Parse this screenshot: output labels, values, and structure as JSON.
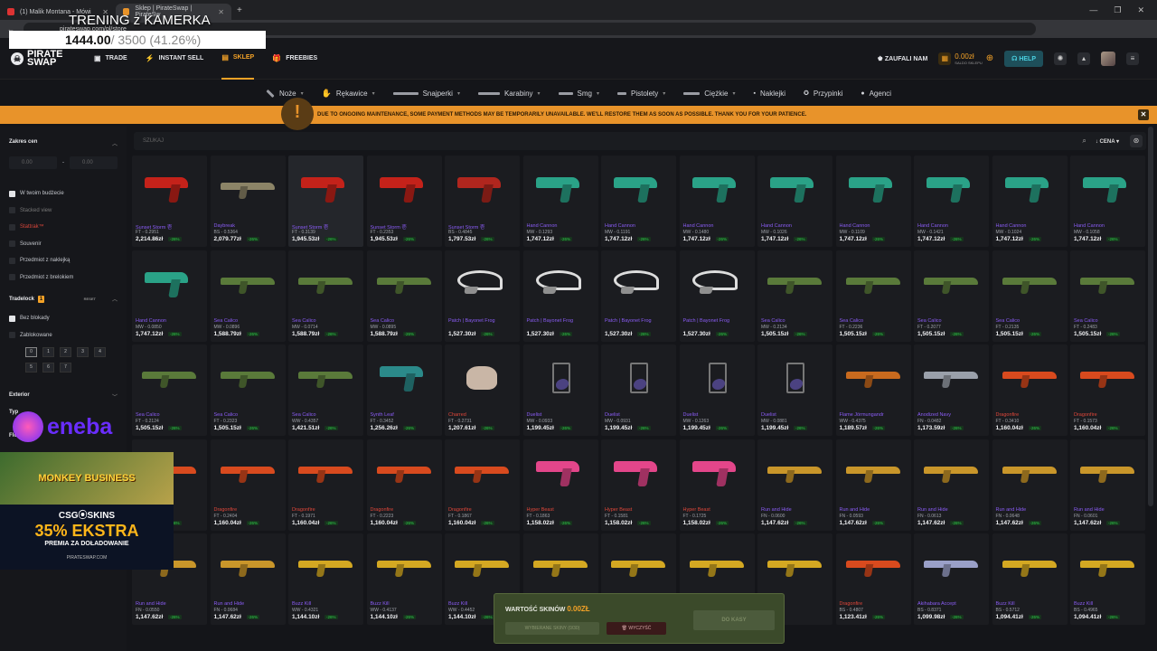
{
  "browser": {
    "tab1": "(1) Malik Montana - Mówi",
    "tab2": "Sklep | PirateSwap | PirateSw",
    "url": "pirateswap.com/pl/store"
  },
  "overlay": {
    "title": "TRENING z KAMERKA",
    "value": "1444.00",
    "rest": " / 3500 (41.26%)"
  },
  "nav": {
    "logo": "PIRATE SWAP",
    "items": [
      "TRADE",
      "INSTANT SELL",
      "SKLEP",
      "FREEBIES"
    ],
    "trust": "ZAUFALI NAM",
    "balance": "0.00zł",
    "balance_sub": "SALDO SKLEPU",
    "help": "HELP"
  },
  "categories": [
    "Noże",
    "Rękawice",
    "Snajperki",
    "Karabiny",
    "Smg",
    "Pistolety",
    "Ciężkie",
    "Naklejki",
    "Przypinki",
    "Agenci"
  ],
  "banner": "DUE TO ONGOING MAINTENANCE, SOME PAYMENT METHODS MAY BE TEMPORARILY UNAVAILABLE. WE'LL RESTORE THEM AS SOON AS POSSIBLE. THANK YOU FOR YOUR PATIENCE.",
  "sidebar": {
    "price_range": "Zakres cen",
    "min": "0.00",
    "max": "0.00",
    "dash": "-",
    "options": [
      "W twoim budżecie",
      "Stacked view",
      "Stattrak™",
      "Souvenir",
      "Przedmiot z naklejką",
      "Przedmiot z brelokiem"
    ],
    "tradelock": "Tradelock",
    "tradelock_badge": "1",
    "reset": "RESET",
    "lock_options": [
      "Bez blokady",
      "Zablokowane"
    ],
    "days": [
      "0",
      "1",
      "2",
      "3",
      "4",
      "5",
      "6",
      "7"
    ],
    "exterior": "Exterior",
    "type": "Typ",
    "float": "Float"
  },
  "ads": {
    "eneba": "eneba",
    "game": "MONKEY BUSINESS",
    "csgo": "CSG⦿SKINS",
    "bonus": "35% EKSTRA",
    "bonus_sub": "PREMIA ZA DOŁADOWANIE",
    "url": "PIRATESWAP.COM"
  },
  "search": {
    "placeholder": "SZUKAJ",
    "sort": "CENA"
  },
  "items": [
    {
      "n": "Sunset Storm 壱",
      "w": "FT - 0.2951",
      "p": "2,214.86zł",
      "c": "#c4221a",
      "k": "pistol"
    },
    {
      "n": "Daybreak",
      "w": "BS - 0.5364",
      "p": "2,079.77zł",
      "c": "#8c8467",
      "k": "rifle"
    },
    {
      "n": "Sunset Storm 壱",
      "w": "FT - 0.3139",
      "p": "1,945.53zł",
      "c": "#c4221a",
      "k": "pistol"
    },
    {
      "n": "Sunset Storm 壱",
      "w": "FT - 0.2353",
      "p": "1,945.53zł",
      "c": "#c4221a",
      "k": "pistol"
    },
    {
      "n": "Sunset Storm 壱",
      "w": "BS - 0.4845",
      "p": "1,797.53zł",
      "c": "#b0261e",
      "k": "pistol"
    },
    {
      "n": "Hand Cannon",
      "w": "MW - 0.1293",
      "p": "1,747.12zł",
      "c": "#2aa287",
      "k": "pistol"
    },
    {
      "n": "Hand Cannon",
      "w": "MW - 0.1191",
      "p": "1,747.12zł",
      "c": "#2aa287",
      "k": "pistol"
    },
    {
      "n": "Hand Cannon",
      "w": "MW - 0.1480",
      "p": "1,747.12zł",
      "c": "#2aa287",
      "k": "pistol"
    },
    {
      "n": "Hand Cannon",
      "w": "MW - 0.1026",
      "p": "1,747.12zł",
      "c": "#2aa287",
      "k": "pistol"
    },
    {
      "n": "Hand Cannon",
      "w": "MW - 0.1109",
      "p": "1,747.12zł",
      "c": "#2aa287",
      "k": "pistol"
    },
    {
      "n": "Hand Cannon",
      "w": "MW - 0.1421",
      "p": "1,747.12zł",
      "c": "#2aa287",
      "k": "pistol"
    },
    {
      "n": "Hand Cannon",
      "w": "MW - 0.1024",
      "p": "1,747.12zł",
      "c": "#2aa287",
      "k": "pistol"
    },
    {
      "n": "Hand Cannon",
      "w": "MW - 0.1058",
      "p": "1,747.12zł",
      "c": "#2aa287",
      "k": "pistol"
    },
    {
      "n": "Hand Cannon",
      "w": "MW - 0.0850",
      "p": "1,747.12zł",
      "c": "#2aa287",
      "k": "pistol"
    },
    {
      "n": "Sea Calico",
      "w": "MW - 0.0896",
      "p": "1,588.79zł",
      "c": "#5a7a3a",
      "k": "rifle"
    },
    {
      "n": "Sea Calico",
      "w": "MW - 0.0714",
      "p": "1,588.79zł",
      "c": "#5a7a3a",
      "k": "rifle"
    },
    {
      "n": "Sea Calico",
      "w": "MW - 0.0895",
      "p": "1,588.79zł",
      "c": "#5a7a3a",
      "k": "rifle"
    },
    {
      "n": "Patch | Bayonet Frog",
      "w": "",
      "p": "1,527.30zł",
      "c": "#e6e6e6",
      "k": "knife"
    },
    {
      "n": "Patch | Bayonet Frog",
      "w": "",
      "p": "1,527.30zł",
      "c": "#e6e6e6",
      "k": "knife"
    },
    {
      "n": "Patch | Bayonet Frog",
      "w": "",
      "p": "1,527.30zł",
      "c": "#e6e6e6",
      "k": "knife"
    },
    {
      "n": "Patch | Bayonet Frog",
      "w": "",
      "p": "1,527.30zł",
      "c": "#e6e6e6",
      "k": "knife"
    },
    {
      "n": "Sea Calico",
      "w": "MW - 0.2134",
      "p": "1,505.15zł",
      "c": "#5a7a3a",
      "k": "rifle"
    },
    {
      "n": "Sea Calico",
      "w": "FT - 0.2236",
      "p": "1,505.15zł",
      "c": "#5a7a3a",
      "k": "rifle"
    },
    {
      "n": "Sea Calico",
      "w": "FT - 0.2077",
      "p": "1,505.15zł",
      "c": "#5a7a3a",
      "k": "rifle"
    },
    {
      "n": "Sea Calico",
      "w": "FT - 0.2135",
      "p": "1,505.15zł",
      "c": "#5a7a3a",
      "k": "rifle"
    },
    {
      "n": "Sea Calico",
      "w": "FT - 0.2483",
      "p": "1,505.15zł",
      "c": "#5a7a3a",
      "k": "rifle"
    },
    {
      "n": "Sea Calico",
      "w": "FT - 0.2124",
      "p": "1,505.15zł",
      "c": "#5a7a3a",
      "k": "rifle"
    },
    {
      "n": "Sea Calico",
      "w": "FT - 0.2323",
      "p": "1,505.15zł",
      "c": "#5a7a3a",
      "k": "rifle"
    },
    {
      "n": "Sea Calico",
      "w": "WW - 0.4357",
      "p": "1,421.51zł",
      "c": "#5a7a3a",
      "k": "rifle"
    },
    {
      "n": "Synth Leaf",
      "w": "FT - 0.3452",
      "p": "1,256.26zł",
      "c": "#2b8a8a",
      "k": "pistol"
    },
    {
      "n": "Charred",
      "w": "FT - 0.2731",
      "p": "1,207.61zł",
      "c": "#c9b6a6",
      "k": "glove",
      "red": true
    },
    {
      "n": "Duelist",
      "w": "MW - 0.0933",
      "p": "1,199.45zł",
      "c": "#6b5fb8",
      "k": "charm"
    },
    {
      "n": "Duelist",
      "w": "MW - 0.0931",
      "p": "1,199.45zł",
      "c": "#6b5fb8",
      "k": "charm"
    },
    {
      "n": "Duelist",
      "w": "MW - 0.1263",
      "p": "1,199.45zł",
      "c": "#6b5fb8",
      "k": "charm"
    },
    {
      "n": "Duelist",
      "w": "MW - 0.0881",
      "p": "1,199.45zł",
      "c": "#6b5fb8",
      "k": "charm"
    },
    {
      "n": "Flame Jörmungandr",
      "w": "WW - 0.4375",
      "p": "1,189.57zł",
      "c": "#c86a1e",
      "k": "rifle"
    },
    {
      "n": "Anodized Navy",
      "w": "FN - 0.0482",
      "p": "1,173.59zł",
      "c": "#9aa0aa",
      "k": "rifle"
    },
    {
      "n": "Dragonfire",
      "w": "FT - 0.3410",
      "p": "1,160.04zł",
      "c": "#d84a1e",
      "k": "rifle",
      "red": true
    },
    {
      "n": "Dragonfire",
      "w": "FT - 0.1573",
      "p": "1,160.04zł",
      "c": "#d84a1e",
      "k": "rifle",
      "red": true
    },
    {
      "n": "Dragonfire",
      "w": "FT - 0.2102",
      "p": "1,160.04zł",
      "c": "#d84a1e",
      "k": "rifle",
      "red": true
    },
    {
      "n": "Dragonfire",
      "w": "FT - 0.2404",
      "p": "1,160.04zł",
      "c": "#d84a1e",
      "k": "rifle",
      "red": true
    },
    {
      "n": "Dragonfire",
      "w": "FT - 0.1971",
      "p": "1,160.04zł",
      "c": "#d84a1e",
      "k": "rifle",
      "red": true
    },
    {
      "n": "Dragonfire",
      "w": "FT - 0.2223",
      "p": "1,160.04zł",
      "c": "#d84a1e",
      "k": "rifle",
      "red": true
    },
    {
      "n": "Dragonfire",
      "w": "FT - 0.1867",
      "p": "1,160.04zł",
      "c": "#d84a1e",
      "k": "rifle",
      "red": true
    },
    {
      "n": "Hyper Beast",
      "w": "FT - 0.1863",
      "p": "1,158.02zł",
      "c": "#e3468a",
      "k": "pistol",
      "red": true
    },
    {
      "n": "Hyper Beast",
      "w": "FT - 0.1581",
      "p": "1,158.02zł",
      "c": "#e3468a",
      "k": "pistol",
      "red": true
    },
    {
      "n": "Hyper Beast",
      "w": "FT - 0.1725",
      "p": "1,158.02zł",
      "c": "#e3468a",
      "k": "pistol",
      "red": true
    },
    {
      "n": "Run and Hide",
      "w": "FN - 0.0600",
      "p": "1,147.62zł",
      "c": "#c9962a",
      "k": "rifle"
    },
    {
      "n": "Run and Hide",
      "w": "FN - 0.0593",
      "p": "1,147.62zł",
      "c": "#c9962a",
      "k": "rifle"
    },
    {
      "n": "Run and Hide",
      "w": "FN - 0.0613",
      "p": "1,147.62zł",
      "c": "#c9962a",
      "k": "rifle"
    },
    {
      "n": "Run and Hide",
      "w": "FN - 0.0648",
      "p": "1,147.62zł",
      "c": "#c9962a",
      "k": "rifle"
    },
    {
      "n": "Run and Hide",
      "w": "FN - 0.0601",
      "p": "1,147.62zł",
      "c": "#c9962a",
      "k": "rifle"
    },
    {
      "n": "Run and Hide",
      "w": "FN - 0.0550",
      "p": "1,147.62zł",
      "c": "#c9962a",
      "k": "rifle"
    },
    {
      "n": "Run and Hide",
      "w": "FN - 0.0684",
      "p": "1,147.62zł",
      "c": "#c9962a",
      "k": "rifle"
    },
    {
      "n": "Buzz Kill",
      "w": "WW - 0.4321",
      "p": "1,144.10zł",
      "c": "#d4a822",
      "k": "rifle"
    },
    {
      "n": "Buzz Kill",
      "w": "WW - 0.4137",
      "p": "1,144.10zł",
      "c": "#d4a822",
      "k": "rifle"
    },
    {
      "n": "Buzz Kill",
      "w": "WW - 0.4452",
      "p": "1,144.10zł",
      "c": "#d4a822",
      "k": "rifle"
    },
    {
      "n": "",
      "w": "",
      "p": "",
      "c": "#d4a822",
      "k": "rifle"
    },
    {
      "n": "",
      "w": "",
      "p": "",
      "c": "#d4a822",
      "k": "rifle"
    },
    {
      "n": "",
      "w": "",
      "p": "",
      "c": "#d4a822",
      "k": "rifle"
    },
    {
      "n": "",
      "w": "..333",
      "p": "",
      "c": "#d4a822",
      "k": "rifle"
    },
    {
      "n": "Dragonfire",
      "w": "BS - 0.4807",
      "p": "1,123.41zł",
      "c": "#d84a1e",
      "k": "rifle",
      "red": true
    },
    {
      "n": "Akihabara Accept",
      "w": "BS - 0.8371",
      "p": "1,099.98zł",
      "c": "#9aa0c8",
      "k": "rifle"
    },
    {
      "n": "Buzz Kill",
      "w": "BS - 0.5712",
      "p": "1,094.41zł",
      "c": "#d4a822",
      "k": "rifle"
    },
    {
      "n": "Buzz Kill",
      "w": "BS - 0.4965",
      "p": "1,094.41zł",
      "c": "#d4a822",
      "k": "rifle"
    }
  ],
  "discount": "-26%",
  "checkout": {
    "label": "WARTOŚĆ SKINÓW",
    "value": "0.00ZŁ",
    "btn1": "WYBIERANE SKINY (0/30)",
    "btn2": "WYCZYŚĆ",
    "btn3": "DO KASY"
  }
}
